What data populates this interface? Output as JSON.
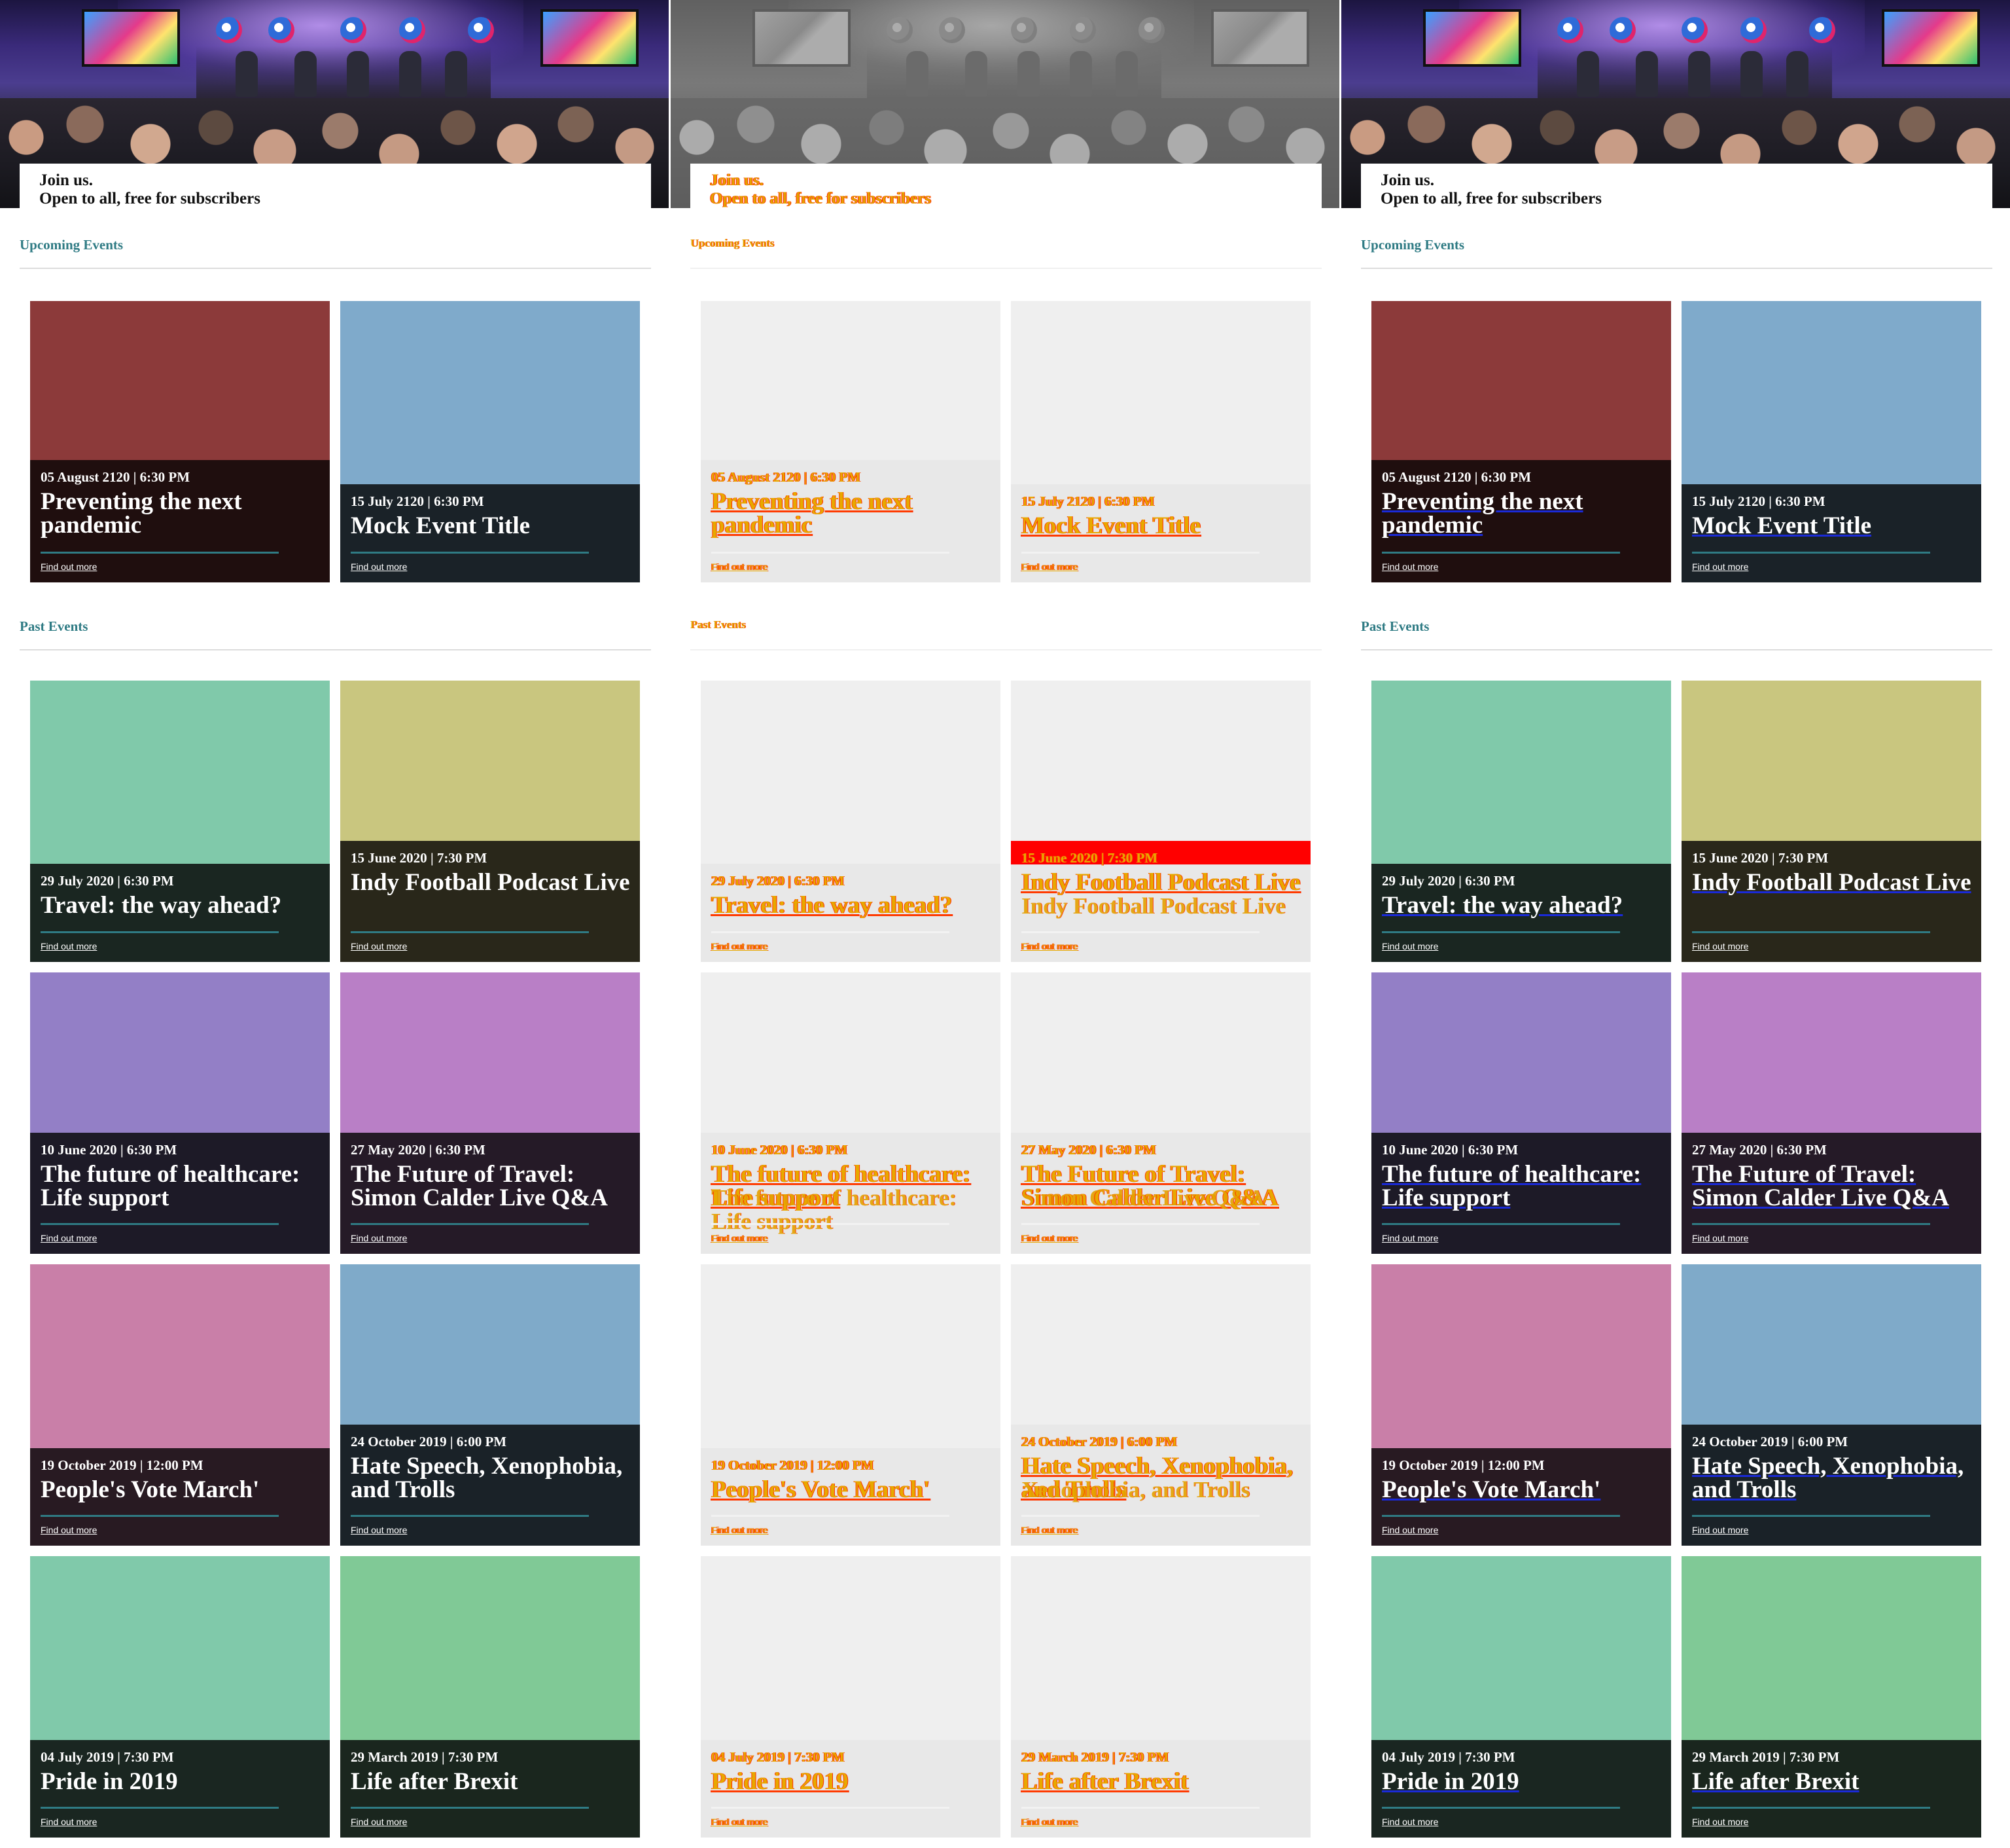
{
  "hero": {
    "line1": "Join us.",
    "line2": "Open to all, free for subscribers"
  },
  "sections": {
    "upcoming": "Upcoming Events",
    "past": "Past Events"
  },
  "link_label": "Find out more",
  "events": [
    {
      "date": "05 August 2120",
      "time": "6:30 PM",
      "title": "Preventing the next pandemic",
      "image_color": "#8c3a3a",
      "band_color": "#1f0e0e"
    },
    {
      "date": "15 July 2120",
      "time": "6:30 PM",
      "title": "Mock Event Title",
      "image_color": "#7faacb",
      "band_color": "#1a2228"
    },
    {
      "date": "29 July 2020",
      "time": "6:30 PM",
      "title": "Travel: the way ahead?",
      "image_color": "#80c9aa",
      "band_color": "#1a2621"
    },
    {
      "date": "15 June 2020",
      "time": "7:30 PM",
      "title": "Indy Football Podcast Live",
      "image_color": "#c9c67f",
      "band_color": "#29271a"
    },
    {
      "date": "10 June 2020",
      "time": "6:30 PM",
      "title": "The future of healthcare: Life support",
      "image_color": "#937fc6",
      "band_color": "#1d1a27"
    },
    {
      "date": "27 May 2020",
      "time": "6:30 PM",
      "title": "The Future of Travel: Simon Calder Live Q&A",
      "image_color": "#b97fc6",
      "band_color": "#251a27"
    },
    {
      "date": "19 October 2019",
      "time": "12:00 PM",
      "title": "People's Vote March'",
      "image_color": "#c97fa8",
      "band_color": "#281a22"
    },
    {
      "date": "24 October 2019",
      "time": "6:00 PM",
      "title": "Hate Speech, Xenophobia, and Trolls",
      "image_color": "#7faac9",
      "band_color": "#1a2228"
    },
    {
      "date": "04 July 2019",
      "time": "7:30 PM",
      "title": "Pride in 2019",
      "image_color": "#80c9aa",
      "band_color": "#1a2621"
    },
    {
      "date": "29 March 2019",
      "time": "7:30 PM",
      "title": "Life after Brexit",
      "image_color": "#80c996",
      "band_color": "#1a261e"
    }
  ],
  "ghost_variant": {
    "line2": "Open to all, free for subscribers",
    "dup_titles": {
      "3": "Indy Football Podcast Live",
      "4": "The future of healthcare: Life support",
      "5": "Simon Calder Live Q&A",
      "7": "Xenophobia, and Trolls"
    },
    "red_accent": "#ff0000"
  },
  "colors": {
    "section_heading": "#2f7b84",
    "link_rule": "#2f7b84",
    "title_underline": "#1a2ad8"
  }
}
